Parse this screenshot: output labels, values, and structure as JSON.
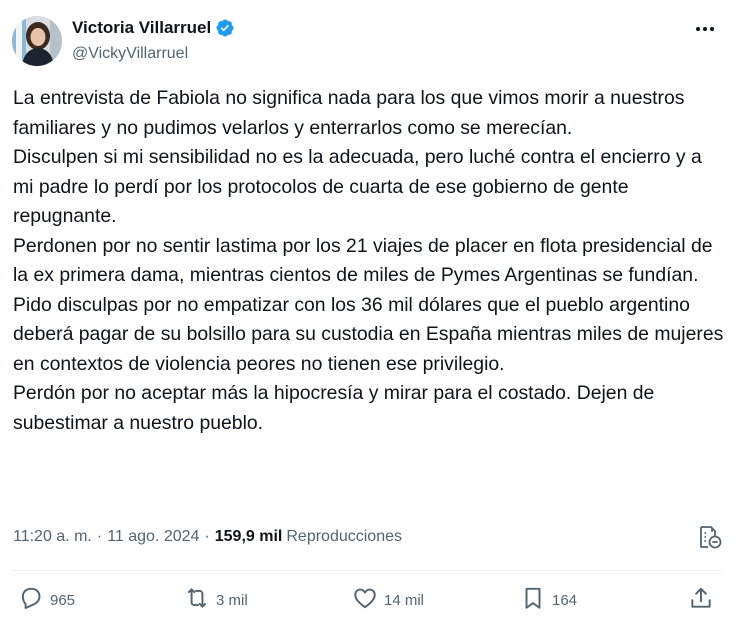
{
  "author": {
    "display_name": "Victoria Villarruel",
    "handle": "@VickyVillarruel",
    "verified": true
  },
  "tweet": {
    "paragraphs": [
      "La entrevista de Fabiola no significa nada para los que vimos morir a nuestros familiares y no pudimos velarlos y enterrarlos como se merecían.",
      "Disculpen si mi sensibilidad no es la adecuada, pero luché contra el encierro y a mi padre lo perdí por los protocolos de cuarta de ese gobierno de gente repugnante.",
      "Perdonen por no sentir lastima por los 21 viajes de placer en flota presidencial de la ex primera dama, mientras cientos de miles de Pymes Argentinas se fundían. Pido disculpas por no empatizar con los 36 mil dólares que el pueblo argentino deberá pagar de su bolsillo para su custodia en España mientras miles de mujeres en contextos de violencia peores no tienen ese privilegio.",
      "Perdón por no aceptar más la hipocresía y mirar para el costado. Dejen de subestimar a nuestro pueblo."
    ],
    "time": "11:20 a. m.",
    "separator": "·",
    "date": "11 ago. 2024",
    "views_count": "159,9 mil",
    "views_label": "Reproducciones"
  },
  "actions": {
    "replies": "965",
    "reposts": "3 mil",
    "likes": "14 mil",
    "bookmarks": "164"
  },
  "icons": {
    "verified": "verified-badge-icon",
    "more": "more-icon",
    "translate": "translate-icon",
    "reply": "reply-icon",
    "repost": "repost-icon",
    "like": "like-icon",
    "bookmark": "bookmark-icon",
    "share": "share-icon"
  },
  "colors": {
    "text": "#0f1419",
    "secondary": "#536471",
    "verified": "#1d9bf0",
    "divider": "#eff3f4"
  }
}
